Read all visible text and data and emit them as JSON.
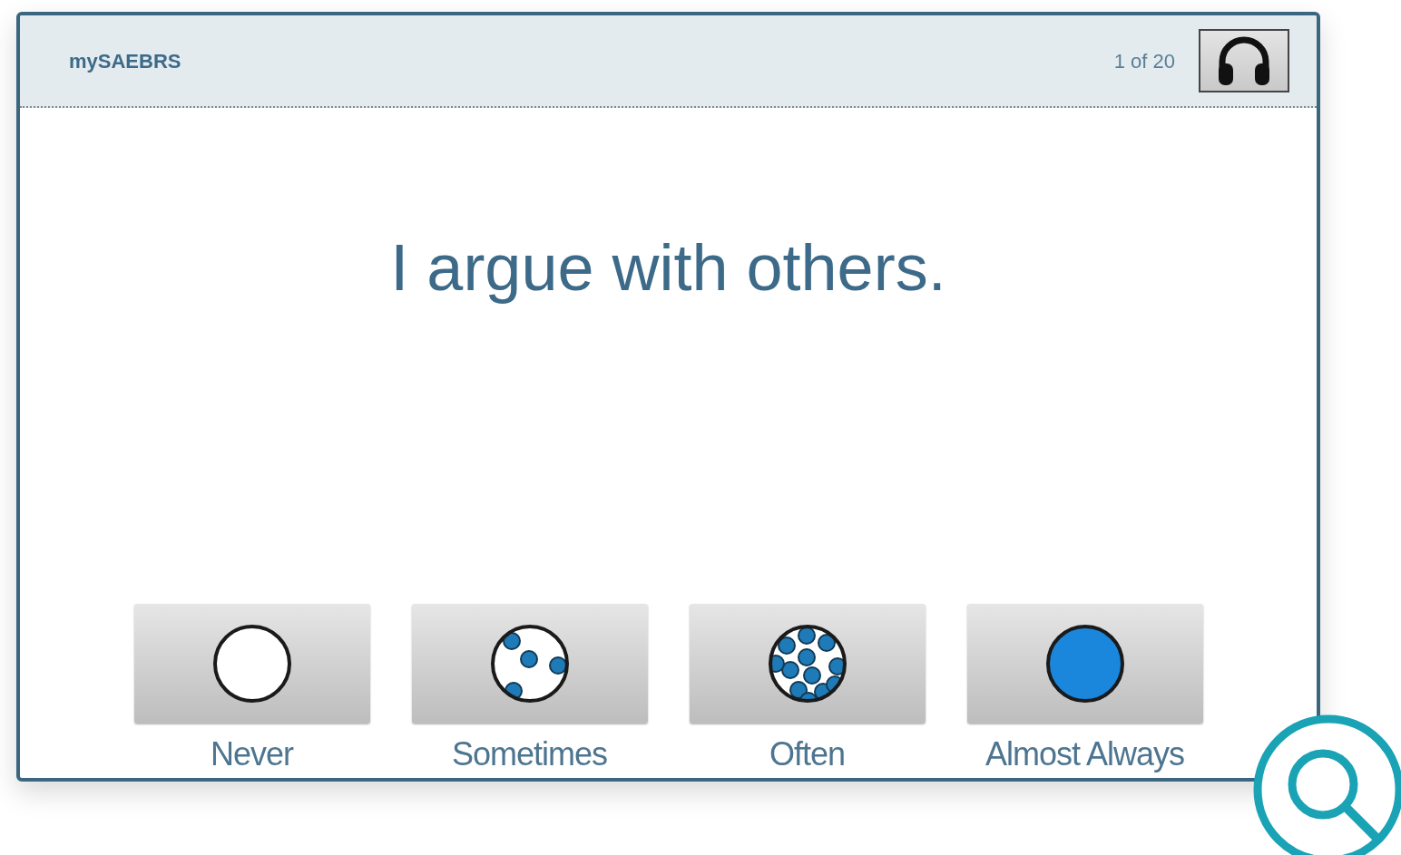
{
  "app": {
    "title": "mySAEBRS",
    "progress": "1 of 20"
  },
  "question": "I argue with others.",
  "options": [
    {
      "kind": "never",
      "label": "Never"
    },
    {
      "kind": "sometimes",
      "label": "Sometimes"
    },
    {
      "kind": "often",
      "label": "Often"
    },
    {
      "kind": "always",
      "label": "Almost Always"
    }
  ]
}
